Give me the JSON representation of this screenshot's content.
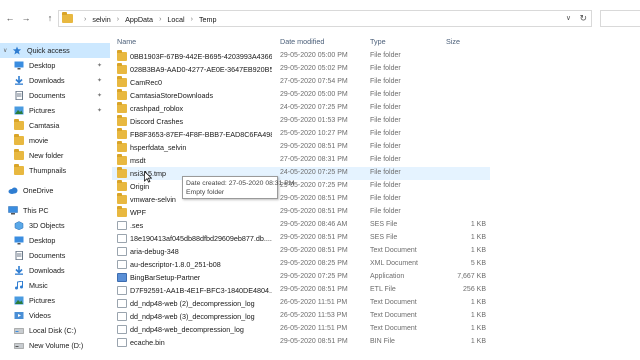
{
  "address": {
    "back_icon": "back-arrow-icon",
    "forward_icon": "forward-arrow-icon",
    "up_icon": "up-arrow-icon",
    "crumbs": [
      "selvin",
      "AppData",
      "Local",
      "Temp"
    ],
    "dropdown_icon": "chevron-down-icon",
    "refresh_icon": "refresh-icon"
  },
  "sidebar": {
    "items": [
      {
        "label": "Quick access",
        "icon": "star-icon",
        "selected": true
      },
      {
        "label": "Desktop",
        "icon": "desktop-icon",
        "pinned": true
      },
      {
        "label": "Downloads",
        "icon": "download-icon",
        "pinned": true
      },
      {
        "label": "Documents",
        "icon": "documents-icon",
        "pinned": true
      },
      {
        "label": "Pictures",
        "icon": "pictures-icon",
        "pinned": true
      },
      {
        "label": "Camtasia",
        "icon": "folder-icon"
      },
      {
        "label": "movie",
        "icon": "folder-icon"
      },
      {
        "label": "New folder",
        "icon": "folder-icon"
      },
      {
        "label": "Thumpnails",
        "icon": "folder-icon"
      },
      {
        "label": "OneDrive",
        "icon": "cloud-icon"
      },
      {
        "label": "This PC",
        "icon": "computer-icon"
      },
      {
        "label": "3D Objects",
        "icon": "cube-icon"
      },
      {
        "label": "Desktop",
        "icon": "desktop-icon"
      },
      {
        "label": "Documents",
        "icon": "documents-icon"
      },
      {
        "label": "Downloads",
        "icon": "download-icon"
      },
      {
        "label": "Music",
        "icon": "music-icon"
      },
      {
        "label": "Pictures",
        "icon": "pictures-icon"
      },
      {
        "label": "Videos",
        "icon": "video-icon"
      },
      {
        "label": "Local Disk (C:)",
        "icon": "drive-icon"
      },
      {
        "label": "New Volume (D:)",
        "icon": "drive-icon"
      }
    ]
  },
  "columns": {
    "name": "Name",
    "date": "Date modified",
    "type": "Type",
    "size": "Size"
  },
  "files": [
    {
      "name": "0BB1903F-67B9-442E-B695-4203993A4366",
      "date": "29-05-2020 05:00 PM",
      "type": "File folder",
      "size": "",
      "kind": "folder"
    },
    {
      "name": "028B3BA9-AAD0-4277-AE0E-3647EB920B54",
      "date": "29-05-2020 05:02 PM",
      "type": "File folder",
      "size": "",
      "kind": "folder"
    },
    {
      "name": "CamRec0",
      "date": "27-05-2020 07:54 PM",
      "type": "File folder",
      "size": "",
      "kind": "folder"
    },
    {
      "name": "CamtasiaStoreDownloads",
      "date": "29-05-2020 05:00 PM",
      "type": "File folder",
      "size": "",
      "kind": "folder"
    },
    {
      "name": "crashpad_roblox",
      "date": "24-05-2020 07:25 PM",
      "type": "File folder",
      "size": "",
      "kind": "folder"
    },
    {
      "name": "Discord Crashes",
      "date": "29-05-2020 01:53 PM",
      "type": "File folder",
      "size": "",
      "kind": "folder"
    },
    {
      "name": "FB8F3653-87EF-4F8F-BBB7-EAD8C6FA4986",
      "date": "25-05-2020 10:27 PM",
      "type": "File folder",
      "size": "",
      "kind": "folder"
    },
    {
      "name": "hsperfdata_selvin",
      "date": "29-05-2020 08:51 PM",
      "type": "File folder",
      "size": "",
      "kind": "folder"
    },
    {
      "name": "msdt",
      "date": "27-05-2020 08:31 PM",
      "type": "File folder",
      "size": "",
      "kind": "folder"
    },
    {
      "name": "nsi3A5.tmp",
      "date": "24-05-2020 07:25 PM",
      "type": "File folder",
      "size": "",
      "kind": "folder",
      "hover": true
    },
    {
      "name": "Origin",
      "date": "29-05-2020 07:25 PM",
      "type": "File folder",
      "size": "",
      "kind": "folder"
    },
    {
      "name": "vmware-selvin",
      "date": "29-05-2020 08:51 PM",
      "type": "File folder",
      "size": "",
      "kind": "folder"
    },
    {
      "name": "WPF",
      "date": "29-05-2020 08:51 PM",
      "type": "File folder",
      "size": "",
      "kind": "folder"
    },
    {
      "name": ".ses",
      "date": "29-05-2020 08:46 AM",
      "type": "SES File",
      "size": "1 KB",
      "kind": "doc"
    },
    {
      "name": "18e190413af045db88dfbd29609eb877.db....",
      "date": "29-05-2020 08:51 PM",
      "type": "SES File",
      "size": "1 KB",
      "kind": "doc"
    },
    {
      "name": "aria-debug-348",
      "date": "29-05-2020 08:51 PM",
      "type": "Text Document",
      "size": "1 KB",
      "kind": "doc"
    },
    {
      "name": "au-descriptor-1.8.0_251-b08",
      "date": "29-05-2020 08:25 PM",
      "type": "XML Document",
      "size": "5 KB",
      "kind": "doc"
    },
    {
      "name": "BingBarSetup-Partner",
      "date": "29-05-2020 07:25 PM",
      "type": "Application",
      "size": "7,667 KB",
      "kind": "app"
    },
    {
      "name": "D7F92591-AA1B-4E1F-BFC3-1840DE4804...",
      "date": "29-05-2020 08:51 PM",
      "type": "ETL File",
      "size": "256 KB",
      "kind": "doc"
    },
    {
      "name": "dd_ndp48-web (2)_decompression_log",
      "date": "26-05-2020 11:51 PM",
      "type": "Text Document",
      "size": "1 KB",
      "kind": "doc"
    },
    {
      "name": "dd_ndp48-web (3)_decompression_log",
      "date": "26-05-2020 11:53 PM",
      "type": "Text Document",
      "size": "1 KB",
      "kind": "doc"
    },
    {
      "name": "dd_ndp48-web_decompression_log",
      "date": "26-05-2020 11:51 PM",
      "type": "Text Document",
      "size": "1 KB",
      "kind": "doc"
    },
    {
      "name": "ecache.bin",
      "date": "29-05-2020 08:51 PM",
      "type": "BIN File",
      "size": "1 KB",
      "kind": "doc"
    }
  ],
  "tooltip": {
    "line1": "Date created: 27-05-2020 08:31 PM",
    "line2": "Empty folder"
  }
}
